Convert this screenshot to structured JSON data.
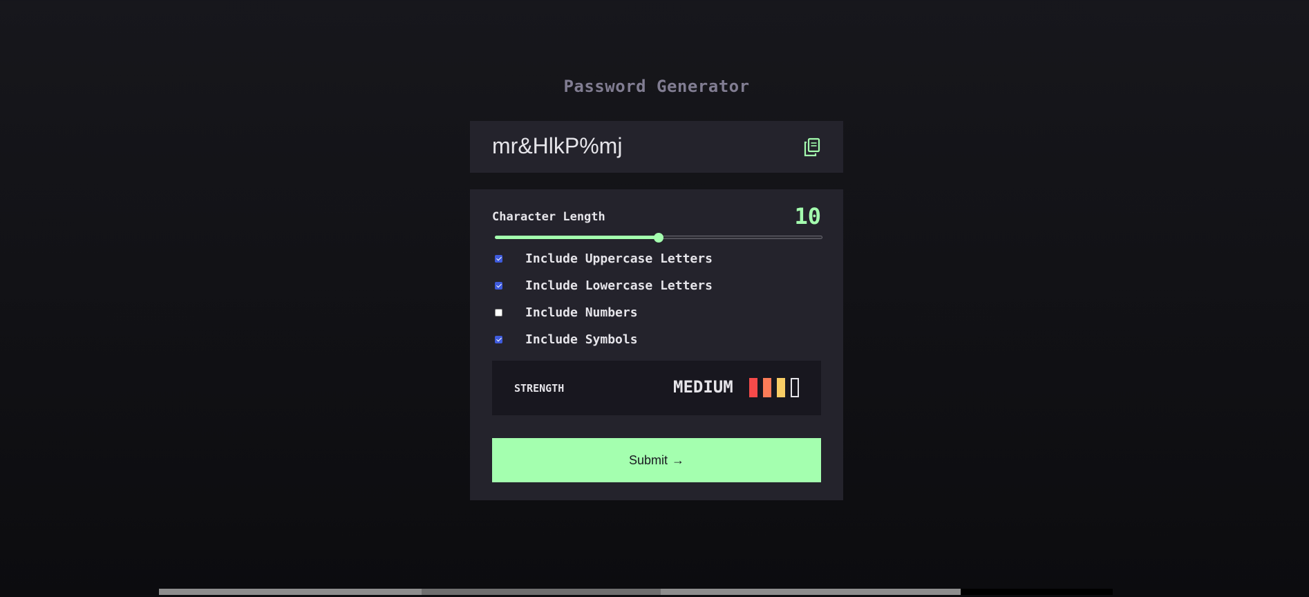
{
  "app": {
    "title": "Password Generator"
  },
  "password": {
    "value": "mr&HlkP%mj",
    "copy_icon": "copy-icon"
  },
  "length": {
    "label": "Character Length",
    "value": "10",
    "min": 0,
    "max": 20
  },
  "options": [
    {
      "label": "Include Uppercase Letters",
      "checked": true
    },
    {
      "label": "Include Lowercase Letters",
      "checked": true
    },
    {
      "label": "Include Numbers",
      "checked": false
    },
    {
      "label": "Include Symbols",
      "checked": true
    }
  ],
  "strength": {
    "label": "STRENGTH",
    "value": "MEDIUM",
    "bars": [
      "#f64a4a",
      "#fb7c58",
      "#f8cd65",
      ""
    ]
  },
  "submit": {
    "label": "Submit",
    "arrow": "→"
  },
  "colors": {
    "accent": "#a4ffaf",
    "panel": "#24232c",
    "background": "#131217"
  }
}
